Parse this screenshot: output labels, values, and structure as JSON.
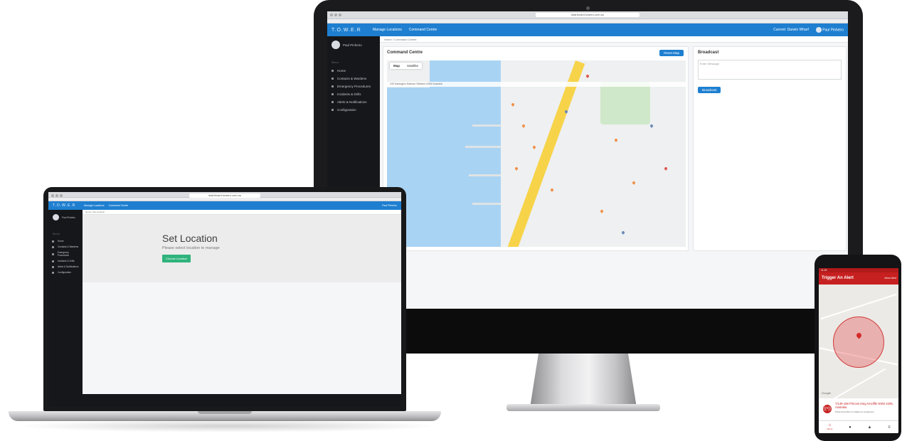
{
  "desktop": {
    "browser_url": "dashboard.towers.com.au",
    "app": {
      "logo": "T.O.W.E.R",
      "nav": [
        "Manage Locations",
        "Command Centre"
      ],
      "user_right": "Paul Pinheiro",
      "location_right": "Current: Darwin Wharf"
    },
    "sidebar": {
      "user_name": "Paul Pinheiro",
      "menu_head": "Menu",
      "items": [
        "Home",
        "Contacts & Wardens",
        "Emergency Procedures",
        "Incidents & Drills",
        "Alerts & Notifications",
        "Configuration"
      ]
    },
    "breadcrumb": "Home / Command Centre",
    "command_centre": {
      "title": "Command Centre",
      "reset_button": "Reset Map",
      "map_tabs": [
        "Map",
        "Satellite"
      ],
      "map_address": "190 Darlington Harbour Western NSW Australia"
    },
    "broadcast": {
      "title": "Broadcast",
      "placeholder": "Enter Message",
      "button": "Broadcast"
    }
  },
  "laptop": {
    "browser_url": "dashboard.towers.com.au",
    "app": {
      "logo": "T.O.W.E.R",
      "nav": [
        "Manage Locations",
        "Command Centre"
      ],
      "user_right": "Paul Pinheiro"
    },
    "sidebar": {
      "user_name": "Paul Pinheiro",
      "menu_head": "Menu",
      "items": [
        "Home",
        "Contacts & Wardens",
        "Emergency Procedures",
        "Incidents & Drills",
        "Alerts & Notifications",
        "Configuration"
      ]
    },
    "breadcrumb": "Home / Set Location",
    "heading": "Set Location",
    "subtext": "Please select location to manage",
    "choose_button": "Choose Location"
  },
  "phone": {
    "status_time": "11:24",
    "title": "Trigger An Alert",
    "title_sub": "Inbox  Alert",
    "map_label": "Google",
    "address": "7/149-159 Princes Hwy,Arncliffe NSW 2205, Australia",
    "description": "Press the button to initiate an emergency",
    "nav_home_label": "Home",
    "colors": {
      "primary": "#c72020"
    }
  },
  "colors": {
    "brand": "#1e7fd0",
    "sidebar": "#15171b",
    "success": "#2fb37c"
  }
}
